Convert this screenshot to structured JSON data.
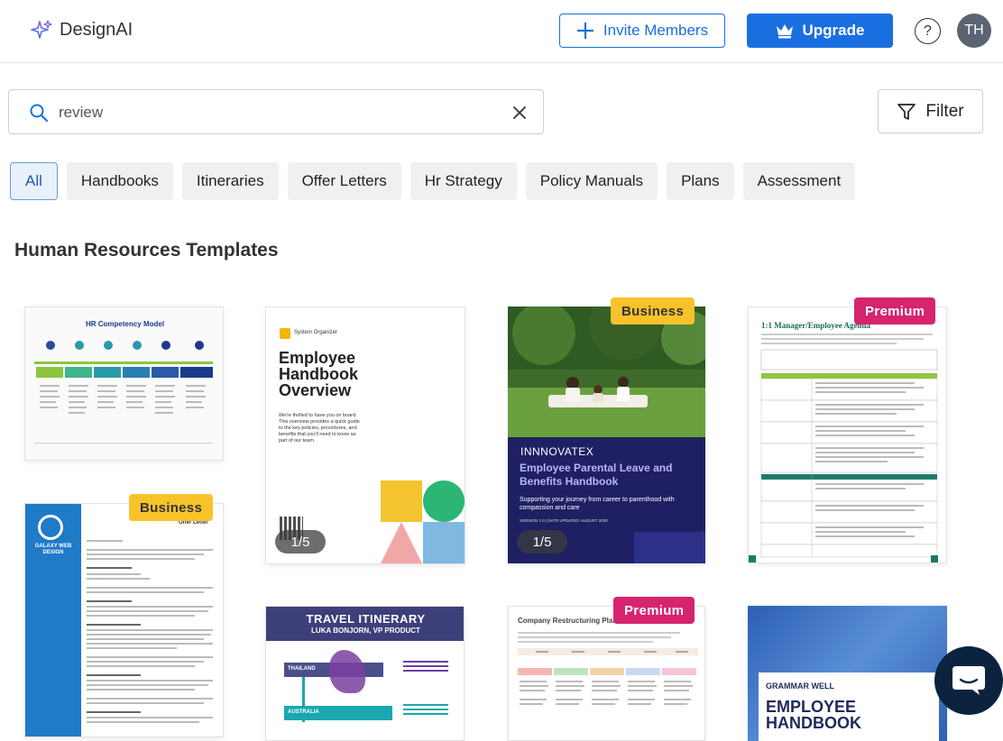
{
  "brand": {
    "name": "DesignAI"
  },
  "header": {
    "invite_label": "Invite Members",
    "upgrade_label": "Upgrade",
    "help_label": "?",
    "avatar_initials": "TH"
  },
  "search": {
    "value": "review",
    "placeholder": ""
  },
  "filter_label": "Filter",
  "chips": [
    "All",
    "Handbooks",
    "Itineraries",
    "Offer Letters",
    "Hr Strategy",
    "Policy Manuals",
    "Plans",
    "Assessment"
  ],
  "section_title": "Human Resources Templates",
  "cards": {
    "hr_competency": {
      "title": "HR Competency Model"
    },
    "employee_handbook": {
      "org": "System Organizer",
      "title": "Employee Handbook Overview",
      "body": "We're thrilled to have you on board. This overview provides a quick guide to the key policies, procedures, and benefits that you'll need to know as part of our team.",
      "pager": "1/5"
    },
    "parental_leave": {
      "badge": "Business",
      "company": "INNNOVATEX",
      "title": "Employee Parental Leave and Benefits Handbook",
      "subtitle": "Supporting your journey from career to parenthood with compassion and care",
      "version": "VERSION 1.0 | DATE UPDATED: AUGUST 2030",
      "pager": "1/5"
    },
    "manager_agenda": {
      "badge": "Premium",
      "title": "1:1 Manager/Employee Agenda"
    },
    "offer_letter": {
      "badge": "Business",
      "company": "GALAXY WEB DESIGN",
      "header": "Offer Letter"
    },
    "travel_itinerary": {
      "title": "TRAVEL ITINERARY",
      "subtitle": "LUKA BONJORN, VP PRODUCT",
      "stops": [
        "THAILAND",
        "AUSTRALIA"
      ]
    },
    "restructuring": {
      "badge": "Premium",
      "title": "Company Restructuring Plan"
    },
    "grammar_handbook": {
      "company": "GRAMMAR WELL",
      "title": "EMPLOYEE HANDBOOK"
    }
  },
  "colors": {
    "primary": "#1a6fe0",
    "business_badge": "#f8c22b",
    "premium_badge": "#d6246e",
    "chat_button": "#0c2340"
  }
}
